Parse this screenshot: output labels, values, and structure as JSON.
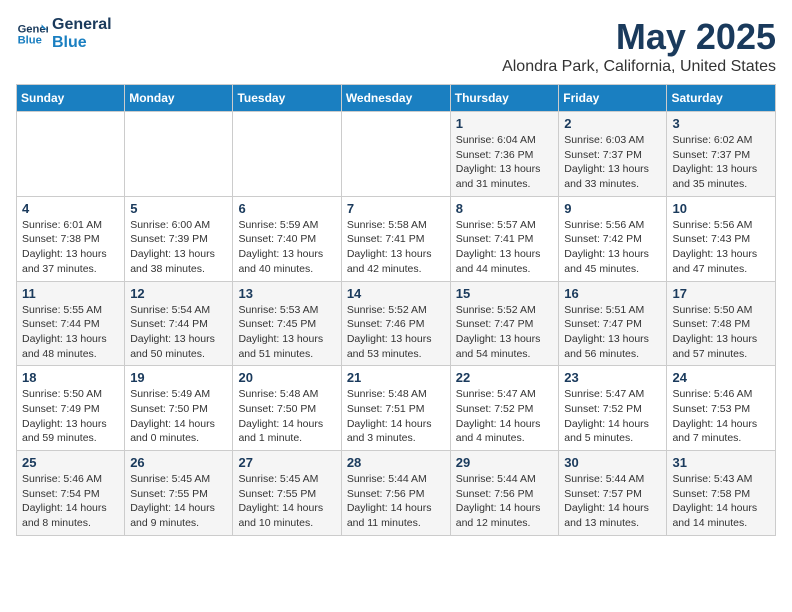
{
  "logo": {
    "line1": "General",
    "line2": "Blue"
  },
  "title": "May 2025",
  "subtitle": "Alondra Park, California, United States",
  "headers": [
    "Sunday",
    "Monday",
    "Tuesday",
    "Wednesday",
    "Thursday",
    "Friday",
    "Saturday"
  ],
  "weeks": [
    [
      {
        "num": "",
        "info": ""
      },
      {
        "num": "",
        "info": ""
      },
      {
        "num": "",
        "info": ""
      },
      {
        "num": "",
        "info": ""
      },
      {
        "num": "1",
        "info": "Sunrise: 6:04 AM\nSunset: 7:36 PM\nDaylight: 13 hours\nand 31 minutes."
      },
      {
        "num": "2",
        "info": "Sunrise: 6:03 AM\nSunset: 7:37 PM\nDaylight: 13 hours\nand 33 minutes."
      },
      {
        "num": "3",
        "info": "Sunrise: 6:02 AM\nSunset: 7:37 PM\nDaylight: 13 hours\nand 35 minutes."
      }
    ],
    [
      {
        "num": "4",
        "info": "Sunrise: 6:01 AM\nSunset: 7:38 PM\nDaylight: 13 hours\nand 37 minutes."
      },
      {
        "num": "5",
        "info": "Sunrise: 6:00 AM\nSunset: 7:39 PM\nDaylight: 13 hours\nand 38 minutes."
      },
      {
        "num": "6",
        "info": "Sunrise: 5:59 AM\nSunset: 7:40 PM\nDaylight: 13 hours\nand 40 minutes."
      },
      {
        "num": "7",
        "info": "Sunrise: 5:58 AM\nSunset: 7:41 PM\nDaylight: 13 hours\nand 42 minutes."
      },
      {
        "num": "8",
        "info": "Sunrise: 5:57 AM\nSunset: 7:41 PM\nDaylight: 13 hours\nand 44 minutes."
      },
      {
        "num": "9",
        "info": "Sunrise: 5:56 AM\nSunset: 7:42 PM\nDaylight: 13 hours\nand 45 minutes."
      },
      {
        "num": "10",
        "info": "Sunrise: 5:56 AM\nSunset: 7:43 PM\nDaylight: 13 hours\nand 47 minutes."
      }
    ],
    [
      {
        "num": "11",
        "info": "Sunrise: 5:55 AM\nSunset: 7:44 PM\nDaylight: 13 hours\nand 48 minutes."
      },
      {
        "num": "12",
        "info": "Sunrise: 5:54 AM\nSunset: 7:44 PM\nDaylight: 13 hours\nand 50 minutes."
      },
      {
        "num": "13",
        "info": "Sunrise: 5:53 AM\nSunset: 7:45 PM\nDaylight: 13 hours\nand 51 minutes."
      },
      {
        "num": "14",
        "info": "Sunrise: 5:52 AM\nSunset: 7:46 PM\nDaylight: 13 hours\nand 53 minutes."
      },
      {
        "num": "15",
        "info": "Sunrise: 5:52 AM\nSunset: 7:47 PM\nDaylight: 13 hours\nand 54 minutes."
      },
      {
        "num": "16",
        "info": "Sunrise: 5:51 AM\nSunset: 7:47 PM\nDaylight: 13 hours\nand 56 minutes."
      },
      {
        "num": "17",
        "info": "Sunrise: 5:50 AM\nSunset: 7:48 PM\nDaylight: 13 hours\nand 57 minutes."
      }
    ],
    [
      {
        "num": "18",
        "info": "Sunrise: 5:50 AM\nSunset: 7:49 PM\nDaylight: 13 hours\nand 59 minutes."
      },
      {
        "num": "19",
        "info": "Sunrise: 5:49 AM\nSunset: 7:50 PM\nDaylight: 14 hours\nand 0 minutes."
      },
      {
        "num": "20",
        "info": "Sunrise: 5:48 AM\nSunset: 7:50 PM\nDaylight: 14 hours\nand 1 minute."
      },
      {
        "num": "21",
        "info": "Sunrise: 5:48 AM\nSunset: 7:51 PM\nDaylight: 14 hours\nand 3 minutes."
      },
      {
        "num": "22",
        "info": "Sunrise: 5:47 AM\nSunset: 7:52 PM\nDaylight: 14 hours\nand 4 minutes."
      },
      {
        "num": "23",
        "info": "Sunrise: 5:47 AM\nSunset: 7:52 PM\nDaylight: 14 hours\nand 5 minutes."
      },
      {
        "num": "24",
        "info": "Sunrise: 5:46 AM\nSunset: 7:53 PM\nDaylight: 14 hours\nand 7 minutes."
      }
    ],
    [
      {
        "num": "25",
        "info": "Sunrise: 5:46 AM\nSunset: 7:54 PM\nDaylight: 14 hours\nand 8 minutes."
      },
      {
        "num": "26",
        "info": "Sunrise: 5:45 AM\nSunset: 7:55 PM\nDaylight: 14 hours\nand 9 minutes."
      },
      {
        "num": "27",
        "info": "Sunrise: 5:45 AM\nSunset: 7:55 PM\nDaylight: 14 hours\nand 10 minutes."
      },
      {
        "num": "28",
        "info": "Sunrise: 5:44 AM\nSunset: 7:56 PM\nDaylight: 14 hours\nand 11 minutes."
      },
      {
        "num": "29",
        "info": "Sunrise: 5:44 AM\nSunset: 7:56 PM\nDaylight: 14 hours\nand 12 minutes."
      },
      {
        "num": "30",
        "info": "Sunrise: 5:44 AM\nSunset: 7:57 PM\nDaylight: 14 hours\nand 13 minutes."
      },
      {
        "num": "31",
        "info": "Sunrise: 5:43 AM\nSunset: 7:58 PM\nDaylight: 14 hours\nand 14 minutes."
      }
    ]
  ]
}
